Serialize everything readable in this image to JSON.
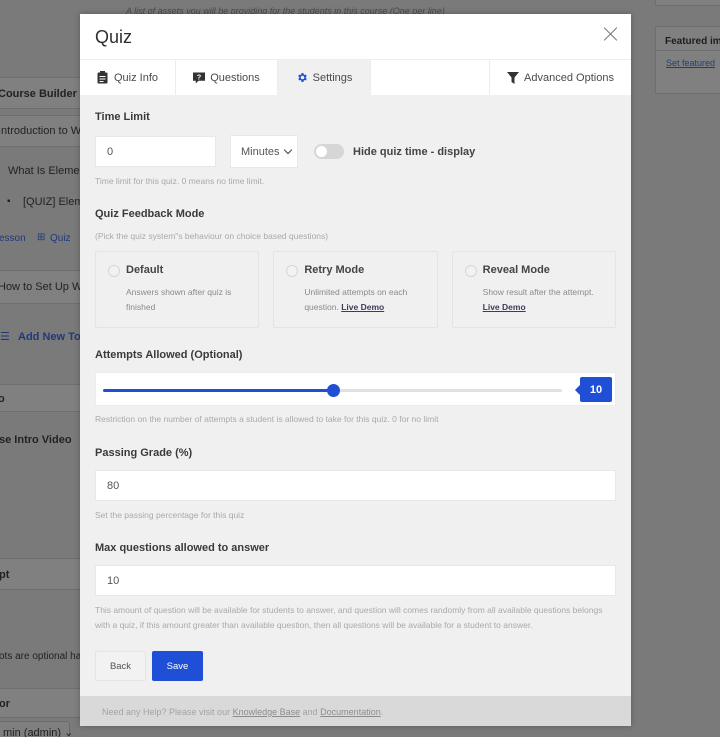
{
  "background": {
    "top_note": "A list of assets you will be providing for the students in this course (One per line)",
    "left": {
      "course_builder": "Course Builder",
      "topic_1": "Introduction to W",
      "lesson_1": "What Is Elemen",
      "quiz_1": "[QUIZ] Elem",
      "add_lesson": "esson",
      "add_quiz": "Quiz",
      "topic_2": "How to Set Up W",
      "add_new_topic": "Add New Top",
      "video_header": "o",
      "video_label": "se Intro Video",
      "excerpt_header": "pt",
      "excerpt_note": "ots are optional ha",
      "author_header": "or",
      "author_select": "min (admin)"
    },
    "right": {
      "featured_title": "Featured im",
      "featured_link": "Set featured"
    }
  },
  "modal": {
    "title": "Quiz",
    "tabs": [
      {
        "label": "Quiz Info",
        "icon": "clipboard-icon",
        "active": false
      },
      {
        "label": "Questions",
        "icon": "question-icon",
        "active": false
      },
      {
        "label": "Settings",
        "icon": "gear-icon",
        "active": true
      },
      {
        "label": "Advanced Options",
        "icon": "filter-icon",
        "active": false
      }
    ],
    "time_limit": {
      "label": "Time Limit",
      "value": "0",
      "unit": "Minutes",
      "toggle_label": "Hide quiz time - display",
      "toggle_on": false,
      "help": "Time limit for this quiz. 0 means no time limit."
    },
    "feedback_mode": {
      "label": "Quiz Feedback Mode",
      "help": "(Pick the quiz system\"s behaviour on choice based questions)",
      "options": [
        {
          "title": "Default",
          "desc": "Answers shown after quiz is finished",
          "link": "",
          "selected": false
        },
        {
          "title": "Retry Mode",
          "desc": "Unlimited attempts on each question.",
          "link": "Live Demo",
          "selected": false
        },
        {
          "title": "Reveal Mode",
          "desc": "Show result after the attempt.",
          "link": "Live Demo",
          "selected": false
        }
      ]
    },
    "attempts": {
      "label": "Attempts Allowed (Optional)",
      "value": "10",
      "fraction": 0.5,
      "help": "Restriction on the number of attempts a student is allowed to take for this quiz. 0 for no limit"
    },
    "passing_grade": {
      "label": "Passing Grade (%)",
      "value": "80",
      "help": "Set the passing percentage for this quiz"
    },
    "max_questions": {
      "label": "Max questions allowed to answer",
      "value": "10",
      "help": "This amount of question will be available for students to answer, and question will comes randomly from all available questions belongs with a quiz, if this amount greater than available question, then all questions will be available for a student to answer."
    },
    "buttons": {
      "back": "Back",
      "save": "Save"
    },
    "footer": {
      "prefix": "Need any Help? Please visit our ",
      "kb_link": "Knowledge Base",
      "mid": " and ",
      "doc_link": "Documentation",
      "suffix": "."
    }
  },
  "colors": {
    "accent": "#1f4fd6",
    "overlay": "#7a7a7a"
  }
}
